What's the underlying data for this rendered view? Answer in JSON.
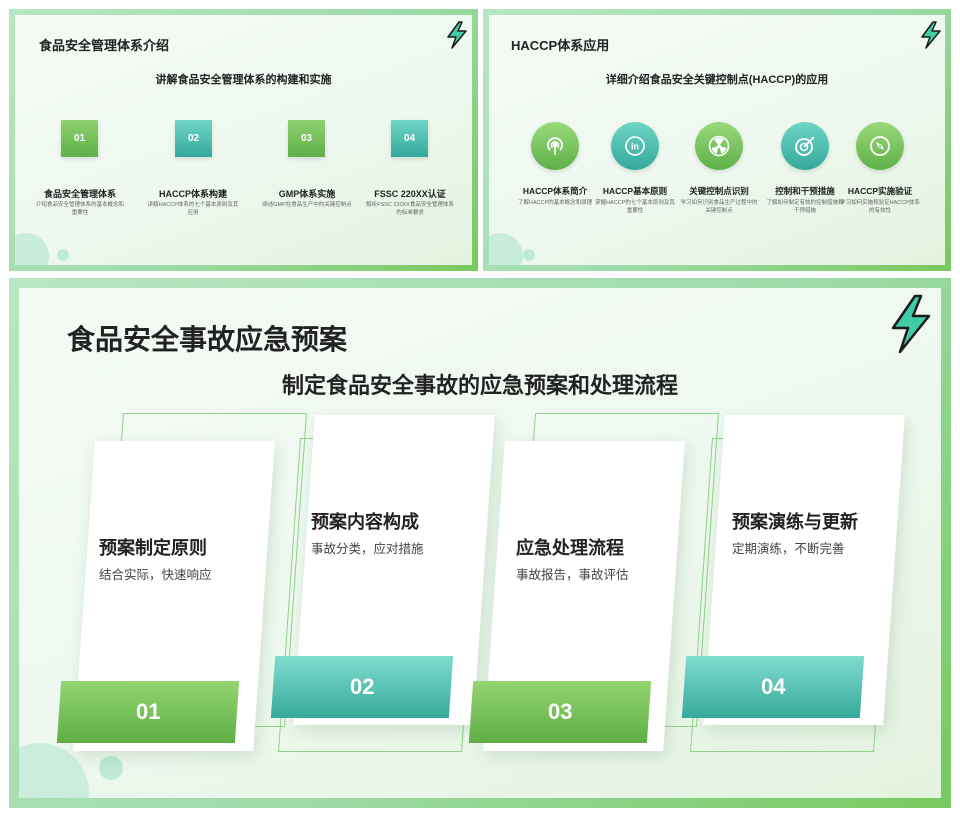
{
  "slide1": {
    "title": "食品安全管理体系介绍",
    "subtitle": "讲解食品安全管理体系的构建和实施",
    "items": [
      {
        "num": "01",
        "label": "食品安全管理体系",
        "desc": "介绍食品安全管理体系的基本概念和重要性"
      },
      {
        "num": "02",
        "label": "HACCP体系构建",
        "desc": "讲解HACCP体系的七个基本原则及其应用"
      },
      {
        "num": "03",
        "label": "GMP体系实施",
        "desc": "阐述GMP在食品生产中的关键控制点"
      },
      {
        "num": "04",
        "label": "FSSC 220XX认证",
        "desc": "解析FSSC 220XX食品安全管理体系的标准要求"
      }
    ]
  },
  "slide2": {
    "title": "HACCP体系应用",
    "subtitle": "详细介绍食品安全关键控制点(HACCP)的应用",
    "items": [
      {
        "icon": "signal-icon",
        "label": "HACCP体系简介",
        "desc": "了解HACCP的基本概念和原理"
      },
      {
        "icon": "linkedin-icon",
        "label": "HACCP基本原则",
        "desc": "掌握HACCP的七个基本原则及其重要性"
      },
      {
        "icon": "radiation-icon",
        "label": "关键控制点识别",
        "desc": "学习如何识别食品生产过程中的关键控制点"
      },
      {
        "icon": "target-icon",
        "label": "控制和干预措施",
        "desc": "了解如何制定有效的控制措施和干预措施"
      },
      {
        "icon": "compass-icon",
        "label": "HACCP实施验证",
        "desc": "学习如何实施和验证HACCP体系的有效性"
      }
    ]
  },
  "slide3": {
    "title": "食品安全事故应急预案",
    "subtitle": "制定食品安全事故的应急预案和处理流程",
    "cards": [
      {
        "num": "01",
        "title": "预案制定原则",
        "desc": "结合实际，快速响应"
      },
      {
        "num": "02",
        "title": "预案内容构成",
        "desc": "事故分类，应对措施"
      },
      {
        "num": "03",
        "title": "应急处理流程",
        "desc": "事故报告，事故评估"
      },
      {
        "num": "04",
        "title": "预案演练与更新",
        "desc": "定期演练，不断完善"
      }
    ]
  },
  "colors": {
    "green": "#7ec45a",
    "teal": "#4ec3ad",
    "frame": "#8fd692",
    "bolt": "#3ecda6"
  },
  "icons": [
    "lightning-bolt-icon"
  ]
}
